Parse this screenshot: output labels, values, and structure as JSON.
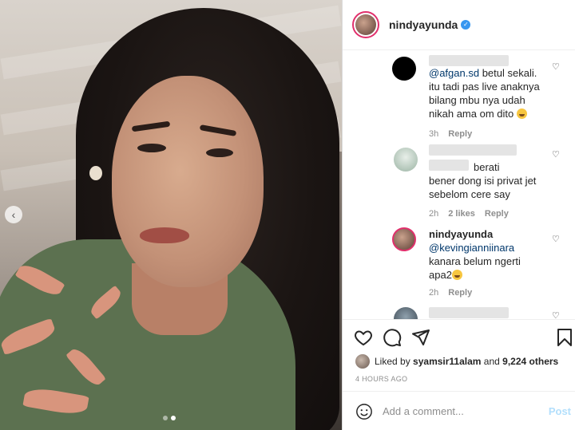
{
  "header": {
    "username": "nindyayunda",
    "verified_icon": "verified-badge-icon"
  },
  "comments": [
    {
      "avatar_icon": "brand-logo-avatar",
      "mention": "@afgan.sd",
      "text": " betul sekali.\nitu tadi pas live anaknya\nbilang mbu nya udah\nnikah ama om dito ",
      "emoji": "laughing-emoji",
      "time": "3h",
      "reply": "Reply"
    },
    {
      "avatar_icon": "user-avatar",
      "text": "berati\nbener dong isi privat jet\nsebelom cere say",
      "time": "2h",
      "likes": "2 likes",
      "reply": "Reply"
    },
    {
      "avatar_icon": "nindyayunda-avatar",
      "username": "nindyayunda",
      "mention": "@kevingianniinara",
      "text": "kanara belum ngerti\napa2",
      "emoji": "laughing-emoji",
      "time": "2h",
      "reply": "Reply"
    }
  ],
  "actions": {
    "icons": [
      "heart-icon",
      "comment-icon",
      "share-icon",
      "bookmark-icon"
    ]
  },
  "likes": {
    "prefix": "Liked by ",
    "user": "syamsir11alam",
    "middle": " and ",
    "count": "9,224 others"
  },
  "timestamp": "4 HOURS AGO",
  "add_comment": {
    "placeholder": "Add a comment...",
    "post_label": "Post"
  },
  "carousel": {
    "slides": 2,
    "current": 2
  }
}
